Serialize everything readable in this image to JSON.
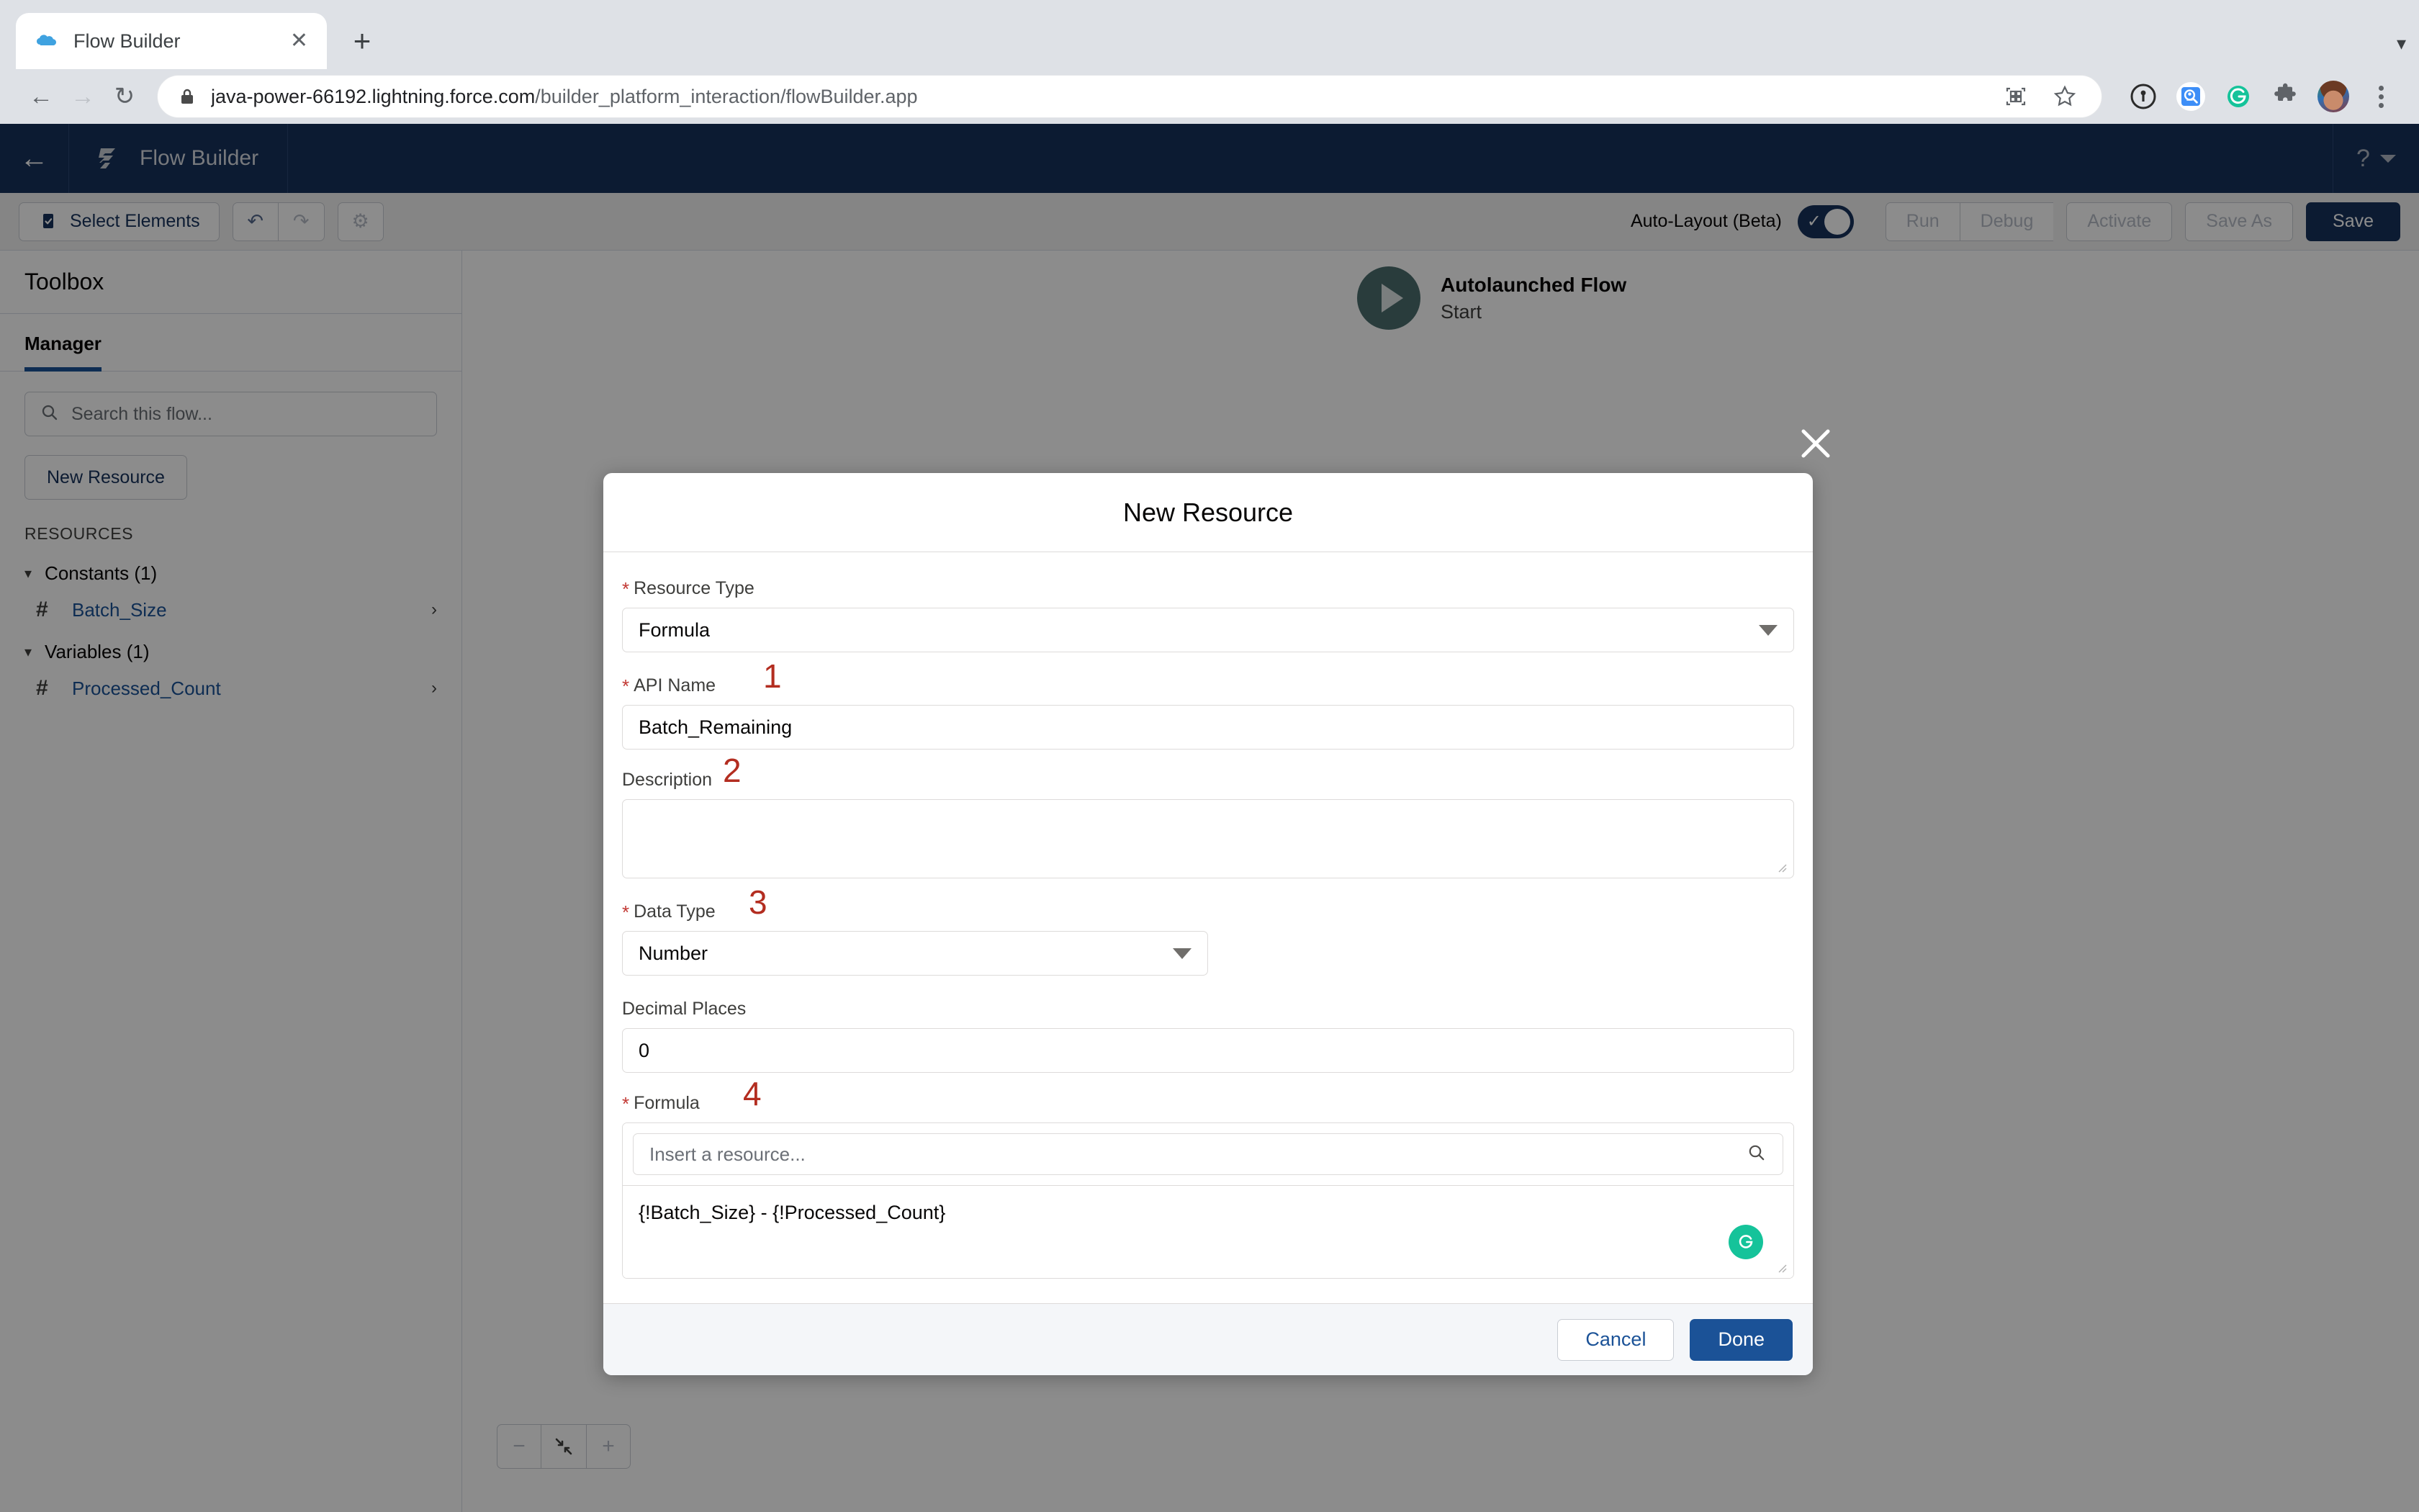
{
  "browser": {
    "tab": {
      "title": "Flow Builder",
      "favicon": "salesforce-cloud-icon",
      "close": "✕"
    },
    "new_tab": "+",
    "nav": {
      "back": "←",
      "forward": "→",
      "reload": "↻"
    },
    "omnibox": {
      "lock": "lock-icon",
      "url_domain": "java-power-66192.lightning.force.com",
      "url_path": "/builder_platform_interaction/flowBuilder.app",
      "qr_icon": "qr-code-icon",
      "bookmark_icon": "star-icon"
    },
    "extensions": [
      {
        "name": "1password-icon"
      },
      {
        "name": "magnifier-extension-icon"
      },
      {
        "name": "grammarly-icon"
      },
      {
        "name": "puzzle-extensions-icon"
      },
      {
        "name": "profile-avatar"
      },
      {
        "name": "chrome-menu-icon"
      }
    ]
  },
  "app_header": {
    "back_arrow": "←",
    "brand_title": "Flow Builder",
    "help": {
      "icon": "?",
      "caret": "caret-down-icon"
    }
  },
  "toolbar": {
    "select_elements": "Select Elements",
    "undo": "↶",
    "redo": "↷",
    "settings": "⚙",
    "autolayout_label": "Auto-Layout (Beta)",
    "autolayout_on": true,
    "toggle_check": "✓",
    "run": "Run",
    "debug": "Debug",
    "activate": "Activate",
    "save_as": "Save As",
    "save": "Save"
  },
  "sidebar": {
    "title": "Toolbox",
    "tabs": [
      {
        "label": "Manager",
        "active": true
      }
    ],
    "search_placeholder": "Search this flow...",
    "new_resource_label": "New Resource",
    "section_title": "RESOURCES",
    "groups": [
      {
        "label": "Constants (1)",
        "items": [
          {
            "icon": "#",
            "label": "Batch_Size"
          }
        ]
      },
      {
        "label": "Variables (1)",
        "items": [
          {
            "icon": "#",
            "label": "Processed_Count"
          }
        ]
      }
    ]
  },
  "canvas": {
    "start_node": {
      "title": "Autolaunched Flow",
      "subtitle": "Start",
      "icon": "play-icon"
    },
    "zoom": {
      "out": "−",
      "fit": "fit-to-view-icon",
      "in": "+"
    }
  },
  "modal": {
    "title": "New Resource",
    "close": "✕",
    "fields": {
      "resource_type": {
        "label": "Resource Type",
        "required": true,
        "value": "Formula"
      },
      "api_name": {
        "label": "API Name",
        "required": true,
        "value": "Batch_Remaining",
        "annotation": "1"
      },
      "description": {
        "label": "Description",
        "required": false,
        "value": "",
        "annotation": "2"
      },
      "data_type": {
        "label": "Data Type",
        "required": true,
        "value": "Number",
        "annotation": "3"
      },
      "decimal_places": {
        "label": "Decimal Places",
        "required": false,
        "value": "0"
      },
      "formula": {
        "label": "Formula",
        "required": true,
        "annotation": "4",
        "insert_placeholder": "Insert a resource...",
        "value": "{!Batch_Size} - {!Processed_Count}"
      }
    },
    "buttons": {
      "cancel": "Cancel",
      "done": "Done"
    }
  },
  "colors": {
    "header_navy": "#16325c",
    "accent_blue": "#1b5297",
    "required_red": "#c23934",
    "annotation_red": "#b32d20",
    "start_teal": "#4b6e6e",
    "grammarly_green": "#15c39a"
  }
}
